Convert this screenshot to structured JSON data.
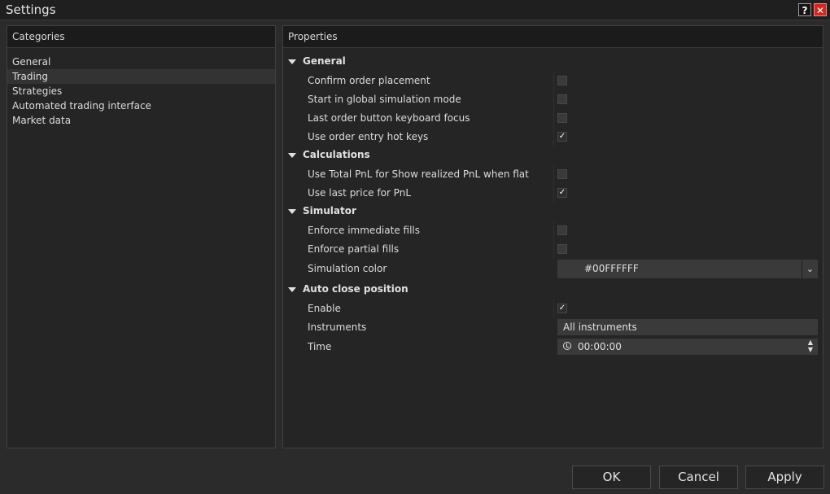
{
  "window": {
    "title": "Settings"
  },
  "categories": {
    "header": "Categories",
    "items": [
      "General",
      "Trading",
      "Strategies",
      "Automated trading interface",
      "Market data"
    ],
    "selected": "Trading"
  },
  "properties": {
    "header": "Properties",
    "sections": [
      {
        "title": "General",
        "items": [
          {
            "label": "Confirm order placement",
            "type": "checkbox",
            "checked": false
          },
          {
            "label": "Start in global simulation mode",
            "type": "checkbox",
            "checked": false
          },
          {
            "label": "Last order button keyboard focus",
            "type": "checkbox",
            "checked": false
          },
          {
            "label": "Use order entry hot keys",
            "type": "checkbox",
            "checked": true
          }
        ]
      },
      {
        "title": "Calculations",
        "items": [
          {
            "label": "Use Total PnL for Show realized PnL when flat",
            "type": "checkbox",
            "checked": false
          },
          {
            "label": "Use last price for PnL",
            "type": "checkbox",
            "checked": true
          }
        ]
      },
      {
        "title": "Simulator",
        "items": [
          {
            "label": "Enforce immediate fills",
            "type": "checkbox",
            "checked": false
          },
          {
            "label": "Enforce partial fills",
            "type": "checkbox",
            "checked": false
          },
          {
            "label": "Simulation color",
            "type": "color",
            "value": "#00FFFFFF"
          }
        ]
      },
      {
        "title": "Auto close position",
        "items": [
          {
            "label": "Enable",
            "type": "checkbox",
            "checked": true
          },
          {
            "label": "Instruments",
            "type": "text",
            "value": "All instruments"
          },
          {
            "label": "Time",
            "type": "time",
            "value": "00:00:00"
          }
        ]
      }
    ]
  },
  "buttons": {
    "ok": "OK",
    "cancel": "Cancel",
    "apply": "Apply"
  },
  "icons": {
    "help": "help-icon",
    "close": "close-icon",
    "expanded": "caret-down-icon",
    "check": "checkmark-icon",
    "dropdown": "chevron-down-icon",
    "clock": "clock-icon",
    "spin": "spin-arrows-icon"
  }
}
